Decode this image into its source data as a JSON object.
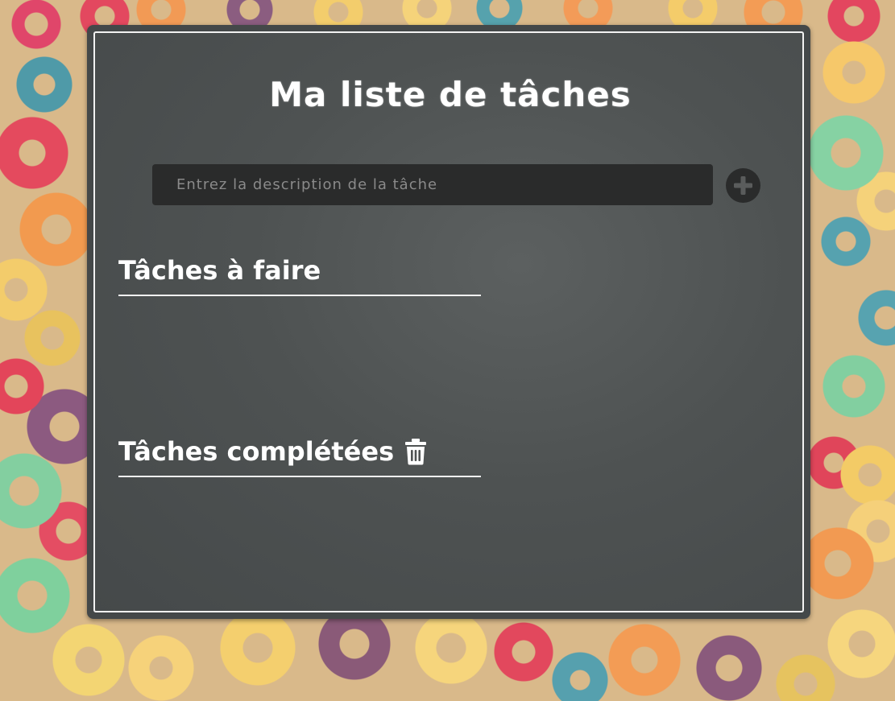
{
  "app": {
    "title": "Ma liste de tâches"
  },
  "new_task": {
    "placeholder": "Entrez la description de la tâche",
    "value": ""
  },
  "add_button": {
    "icon": "plus-circle-icon"
  },
  "sections": {
    "todo": {
      "heading": "Tâches à faire",
      "items": []
    },
    "done": {
      "heading": "Tâches complétées",
      "clear_icon": "trash-icon",
      "items": []
    }
  },
  "colors": {
    "board": "#4e5252",
    "chalk": "#ffffff",
    "input_bg": "#2a2b2b",
    "placeholder": "#8a8a8a"
  }
}
